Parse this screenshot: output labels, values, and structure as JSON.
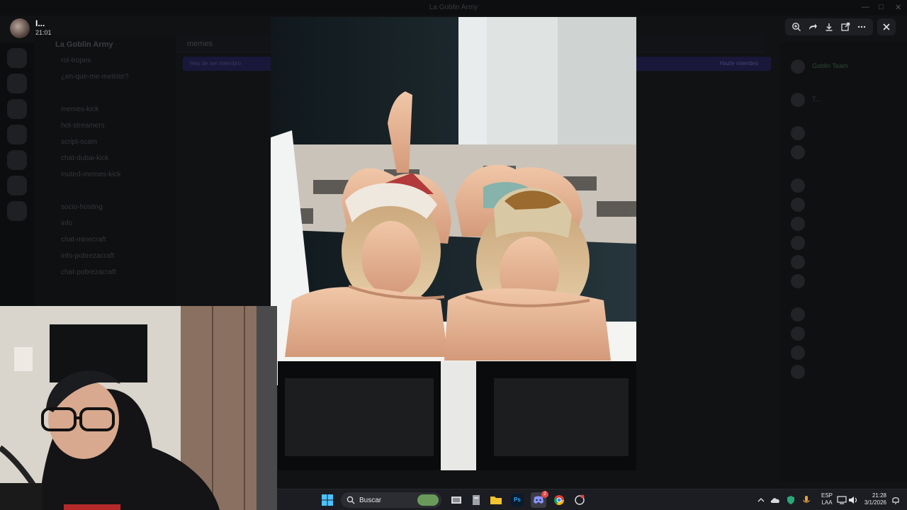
{
  "window": {
    "title": "La Goblin Army"
  },
  "viewer": {
    "user_name": "I...",
    "time": "21:01",
    "tools": [
      {
        "icon": "zoom-in-icon"
      },
      {
        "icon": "forward-icon"
      },
      {
        "icon": "download-icon"
      },
      {
        "icon": "open-external-icon"
      },
      {
        "icon": "more-icon"
      }
    ],
    "close_icon": "close-icon"
  },
  "server": {
    "name": "La Goblin Army"
  },
  "channels": [
    "rol-tropes",
    "¿en-que-me-metiste?",
    "",
    "memes-kick",
    "hot-streamers",
    "script-scam",
    "chat-dubai-kick",
    "muted-memes-kick",
    "",
    "socio-hosting",
    "info",
    "chat-minecraft",
    "info-pobrezacraft",
    "chat-pobrezacraft"
  ],
  "chat": {
    "channel": "memes",
    "banner_text": "Has de ser miembro",
    "banner_link": "Hazte miembro"
  },
  "members": {
    "groups": [
      {
        "header": "",
        "names": [
          "Goblin Team"
        ]
      },
      {
        "header": "",
        "names": [
          "T..."
        ]
      },
      {
        "header": "",
        "names": [
          "",
          ""
        ]
      },
      {
        "header": "",
        "names": [
          "",
          "",
          "",
          "",
          "",
          ""
        ]
      },
      {
        "header": "",
        "names": [
          "",
          "",
          "",
          ""
        ]
      }
    ]
  },
  "taskbar": {
    "search_label": "Buscar",
    "apps": [
      "file-explorer-icon",
      "files-icon",
      "folder-icon",
      "photoshop-icon",
      "discord-icon",
      "chrome-icon",
      "app-icon"
    ],
    "photoshop_label": "Ps",
    "discord_badge": "2",
    "lang_line1": "ESP",
    "lang_line2": "LAA",
    "time": "21:28",
    "date": "3/1/2026"
  },
  "colors": {
    "accent": "#5865f2",
    "taskbar": "#1c1d22",
    "banner": "#19183a"
  }
}
